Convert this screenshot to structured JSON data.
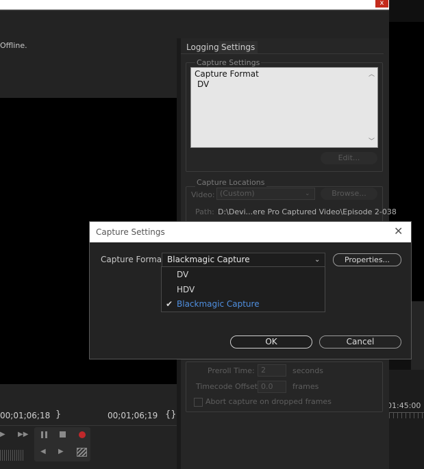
{
  "window": {
    "close_glyph": "x",
    "status_text": "Offline."
  },
  "tabs": [
    {
      "label": "Logging"
    },
    {
      "label": "Settings"
    }
  ],
  "capture_settings_group": {
    "title": "Capture Settings",
    "lines": [
      "Capture Format",
      "DV"
    ],
    "edit_label": "Edit..."
  },
  "capture_locations_group": {
    "title": "Capture Locations",
    "video_label": "Video:",
    "video_value": "(Custom)",
    "browse_label": "Browse...",
    "path_label": "Path:",
    "path_value": "D:\\Devi...ere Pro Captured Video\\Episode 2-038"
  },
  "device_options": {
    "preroll_label": "Preroll Time:",
    "preroll_value": "2",
    "preroll_unit": "seconds",
    "offset_label": "Timecode Offset:",
    "offset_value": "0.0",
    "offset_unit": "frames",
    "abort_label": "Abort capture on dropped frames"
  },
  "timecodes": {
    "in": "00;01;06;18",
    "out": "00;01;06;19",
    "right": "01:45:00"
  },
  "dialog": {
    "title": "Capture Settings",
    "format_label": "Capture Format:",
    "format_value": "Blackmagic Capture",
    "properties_label": "Properties...",
    "ok_label": "OK",
    "cancel_label": "Cancel",
    "options": [
      "DV",
      "HDV",
      "Blackmagic Capture"
    ],
    "selected_index": 2
  },
  "colors": {
    "selected_option": "#4f8fe0",
    "record_button": "#c0282b",
    "close_button": "#c42b1c"
  },
  "icons": [
    "close-icon",
    "chevron-down-icon",
    "check-icon",
    "pause-icon",
    "stop-icon",
    "record-icon",
    "play-icon",
    "fast-forward-icon",
    "clapper-icon"
  ]
}
